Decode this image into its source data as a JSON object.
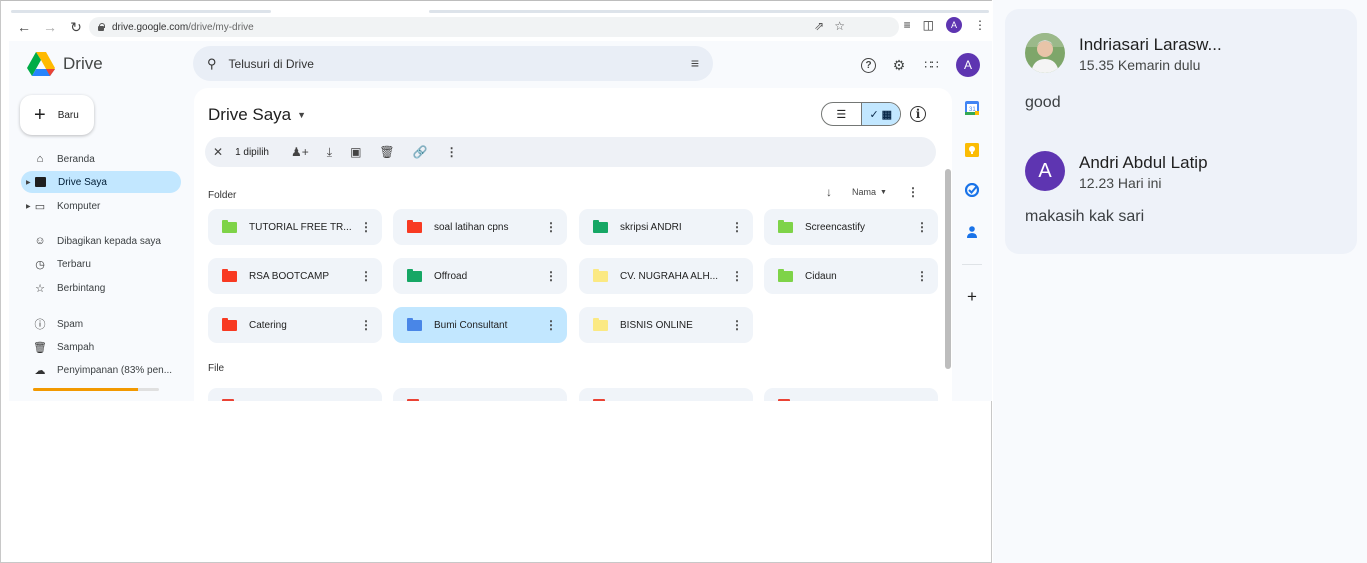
{
  "browser": {
    "url_host": "drive.google.com",
    "url_path": "/drive/my-drive",
    "profile_initial": "A"
  },
  "app": {
    "name": "Drive",
    "search_placeholder": "Telusuri di Drive",
    "account_initial": "A"
  },
  "sidebar": {
    "new_label": "Baru",
    "items": [
      {
        "label": "Beranda",
        "icon": "home-icon"
      },
      {
        "label": "Drive Saya",
        "icon": "my-drive-icon",
        "active": true
      },
      {
        "label": "Komputer",
        "icon": "computer-icon"
      },
      {
        "label": "Dibagikan kepada saya",
        "icon": "shared-icon"
      },
      {
        "label": "Terbaru",
        "icon": "clock-icon"
      },
      {
        "label": "Berbintang",
        "icon": "star-icon"
      },
      {
        "label": "Spam",
        "icon": "spam-icon"
      },
      {
        "label": "Sampah",
        "icon": "trash-icon"
      },
      {
        "label": "Penyimpanan (83% pen...",
        "icon": "cloud-icon"
      }
    ],
    "storage_used_percent": 83,
    "storage_color": "#f29900"
  },
  "main": {
    "title": "Drive Saya",
    "selection_count": "1 dipilih",
    "folder_section": "Folder",
    "file_section": "File",
    "sort_label": "Nama",
    "folders": [
      {
        "name": "TUTORIAL FREE TR...",
        "color": "#7ed348"
      },
      {
        "name": "soal latihan cpns",
        "color": "#f83a22"
      },
      {
        "name": "skripsi ANDRI",
        "color": "#16a765"
      },
      {
        "name": "Screencastify",
        "color": "#7ed348"
      },
      {
        "name": "RSA BOOTCAMP",
        "color": "#f83a22"
      },
      {
        "name": "Offroad",
        "color": "#16a765"
      },
      {
        "name": "CV. NUGRAHA ALH...",
        "color": "#fbe983"
      },
      {
        "name": "Cidaun",
        "color": "#7ed348"
      },
      {
        "name": "Catering",
        "color": "#f83a22"
      },
      {
        "name": "Bumi Consultant",
        "color": "#4986e7",
        "selected": true
      },
      {
        "name": "BISNIS ONLINE",
        "color": "#fbe983"
      }
    ]
  },
  "comments": [
    {
      "author": "Indriasari Larasw...",
      "time": "15.35 Kemarin dulu",
      "text": "good"
    },
    {
      "author": "Andri Abdul Latip",
      "time": "12.23 Hari ini",
      "text": "makasih kak sari",
      "initial": "A"
    }
  ]
}
